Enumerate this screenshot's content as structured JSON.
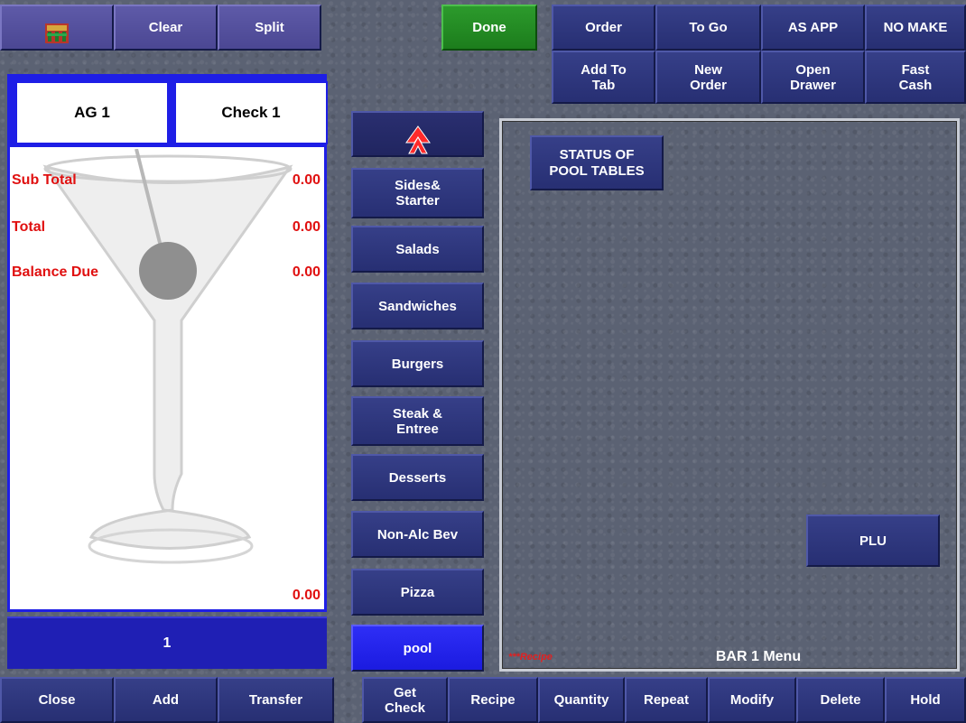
{
  "top_bar": {
    "clear": "Clear",
    "split": "Split",
    "done": "Done",
    "order": "Order",
    "to_go": "To Go",
    "as_app": "AS APP",
    "no_make": "NO MAKE"
  },
  "second_bar": {
    "add_to_tab": "Add To\nTab",
    "new_order": "New\nOrder",
    "open_drawer": "Open\nDrawer",
    "fast_cash": "Fast\nCash"
  },
  "check": {
    "seat_tab": "AG 1",
    "check_tab": "Check 1",
    "sub_total_label": "Sub Total",
    "sub_total_value": "0.00",
    "total_label": "Total",
    "total_value": "0.00",
    "balance_due_label": "Balance Due",
    "balance_due_value": "0.00",
    "footer_value": "0.00",
    "seat_number": "1"
  },
  "categories": {
    "sides_starter": "Sides&\nStarter",
    "salads": "Salads",
    "sandwiches": "Sandwiches",
    "burgers": "Burgers",
    "steak_entree": "Steak &\nEntree",
    "desserts": "Desserts",
    "non_alc_bev": "Non-Alc Bev",
    "pizza": "Pizza",
    "pool": "pool"
  },
  "menu": {
    "status_pool_tables": "STATUS OF\nPOOL TABLES",
    "plu": "PLU",
    "recipe_hint": "***Recipe",
    "title": "BAR 1 Menu"
  },
  "bottom_bar": {
    "close": "Close",
    "add": "Add",
    "transfer": "Transfer",
    "get_check": "Get\nCheck",
    "recipe": "Recipe",
    "quantity": "Quantity",
    "repeat": "Repeat",
    "modify": "Modify",
    "delete": "Delete",
    "hold": "Hold"
  },
  "icons": {
    "home": "table-icon",
    "scroll_up": "scroll-up-icon"
  },
  "colors": {
    "button_blue": "#2f3780",
    "button_purple": "#55519e",
    "done_green": "#229022",
    "active_blue": "#2424ee",
    "total_red": "#e01010",
    "check_border": "#1e1ee6"
  }
}
